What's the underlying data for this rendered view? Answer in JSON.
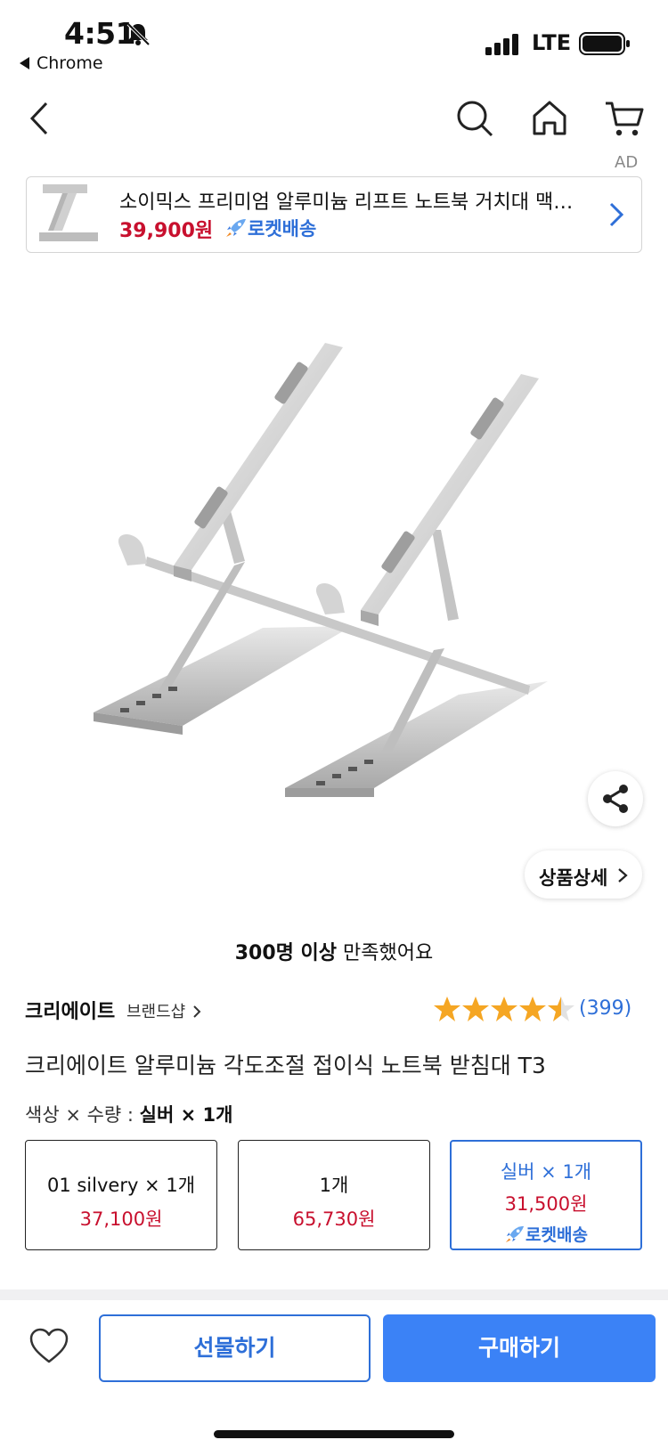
{
  "status_bar": {
    "time": "4:51",
    "back_app": "Chrome",
    "network": "LTE"
  },
  "nav": {
    "back_icon": "chevron-left-icon",
    "search_icon": "search-icon",
    "home_icon": "home-icon",
    "cart_icon": "cart-icon"
  },
  "ad": {
    "label": "AD",
    "title": "소이믹스 프리미엄 알루미늄 리프트 노트북 거치대 맥북 스탠드",
    "price": "39,900원",
    "delivery": "로켓배송"
  },
  "product": {
    "detail_button": "상품상세",
    "satisfaction_bold": "300명 이상",
    "satisfaction_rest": " 만족했어요",
    "brand": "크리에이트",
    "brand_shop": "브랜드샵",
    "rating": 4.5,
    "rating_count": "(399)",
    "title": "크리에이트 알루미늄 각도조절 접이식 노트북 받침대 T3"
  },
  "options": {
    "label_prefix": "색상 × 수량 : ",
    "label_selected": "실버 × 1개",
    "items": [
      {
        "name": "01 silvery × 1개",
        "price": "37,100원",
        "delivery": ""
      },
      {
        "name": "1개",
        "price": "65,730원",
        "delivery": ""
      },
      {
        "name": "실버 × 1개",
        "price": "31,500원",
        "delivery": "로켓배송"
      }
    ]
  },
  "bottom_bar": {
    "gift_label": "선물하기",
    "buy_label": "구매하기"
  },
  "colors": {
    "accent_blue": "#2e6fd8",
    "price_red": "#c8102e",
    "star": "#f5a623"
  }
}
